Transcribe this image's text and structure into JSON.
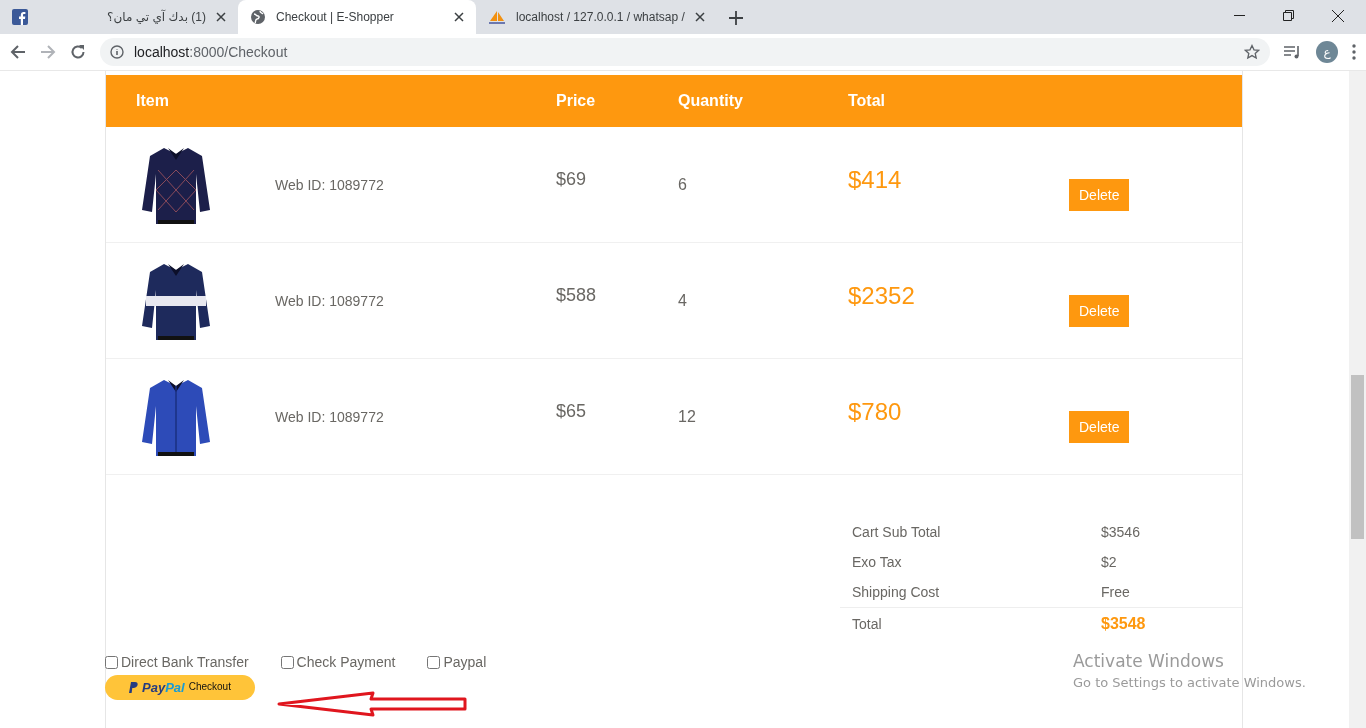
{
  "browser": {
    "tabs": [
      {
        "kind": "facebook",
        "title": "(1) بدك آي تي مان؟",
        "selected": false
      },
      {
        "kind": "globe",
        "title": "Checkout | E-Shopper",
        "selected": true
      },
      {
        "kind": "pma",
        "title": "localhost / 127.0.0.1 / whatsap /",
        "selected": false
      }
    ],
    "address": {
      "host": "localhost",
      "path": ":8000/Checkout"
    },
    "profile_initial": "ع"
  },
  "table": {
    "columns": [
      "Item",
      "",
      "Price",
      "Quantity",
      "Total"
    ],
    "rows": [
      {
        "kind": "picture",
        "description": "Web ID: 1089772",
        "price": "$69",
        "quantity": "6",
        "total": "$414",
        "action": "Delete"
      },
      {
        "kind": "picture",
        "description": "Web ID: 1089772",
        "price": "$588",
        "quantity": "4",
        "total": "$2352",
        "action": "Delete"
      },
      {
        "kind": "picture",
        "description": "Web ID: 1089772",
        "price": "$65",
        "quantity": "12",
        "total": "$780",
        "action": "Delete"
      }
    ]
  },
  "summary": [
    {
      "label": "Cart Sub Total",
      "value": "$3546",
      "kind": "plain"
    },
    {
      "label": "Exo Tax",
      "value": "$2",
      "kind": "plain"
    },
    {
      "label": "Shipping Cost",
      "value": "Free",
      "kind": "plain"
    },
    {
      "label": "Total",
      "value": "$3548",
      "kind": "total"
    }
  ],
  "payment_options": [
    {
      "label": "Direct Bank Transfer",
      "checked": false
    },
    {
      "label": "Check Payment",
      "checked": false
    },
    {
      "label": "Paypal",
      "checked": false
    }
  ],
  "paypal_button": {
    "brand_a": "Pay",
    "brand_b": "Pal",
    "label": "Checkout"
  },
  "activation_notice": {
    "title": "Activate Windows",
    "subtitle": "Go to Settings to activate Windows."
  }
}
